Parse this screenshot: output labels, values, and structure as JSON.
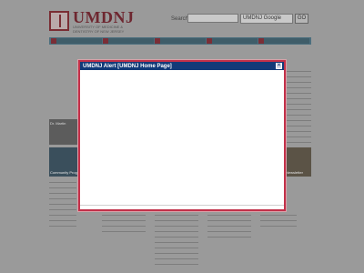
{
  "site": {
    "logo_text": "UMDNJ",
    "logo_subtitle": "UNIVERSITY OF MEDICINE & DENTISTRY OF NEW JERSEY"
  },
  "search": {
    "label": "Search",
    "scope": "UMDNJ Google",
    "go_label": "GO"
  },
  "modal": {
    "title": "UMDNJ Alert [UMDNJ Home Page]",
    "close_label": "✕"
  },
  "background": {
    "photo_caption": "Dr. Martin",
    "left_strip_caption": "Community Programs",
    "right_strip_caption": "Newsletter"
  }
}
